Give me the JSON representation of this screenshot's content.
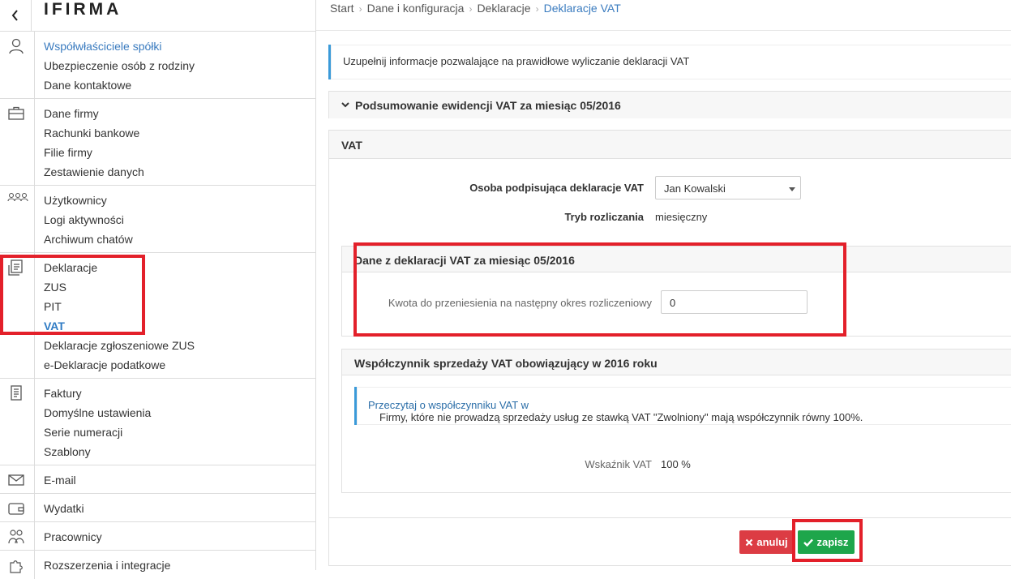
{
  "app": {
    "logo": "IFIRMA"
  },
  "sidebar": {
    "groups": [
      {
        "icon": "person-icon",
        "items": [
          "Współwłaściciele spółki",
          "Ubezpieczenie osób z rodziny",
          "Dane kontaktowe"
        ]
      },
      {
        "icon": "briefcase-icon",
        "items": [
          "Dane firmy",
          "Rachunki bankowe",
          "Filie firmy",
          "Zestawienie danych"
        ]
      },
      {
        "icon": "users-icon",
        "items": [
          "Użytkownicy",
          "Logi aktywności",
          "Archiwum chatów"
        ]
      },
      {
        "icon": "declaration-icon",
        "items": [
          "Deklaracje",
          "ZUS",
          "PIT",
          "VAT",
          "Deklaracje zgłoszeniowe ZUS",
          "e-Deklaracje podatkowe"
        ]
      },
      {
        "icon": "invoice-icon",
        "items": [
          "Faktury",
          "Domyślne ustawienia",
          "Serie numeracji",
          "Szablony"
        ]
      },
      {
        "icon": "envelope-icon",
        "items": [
          "E-mail"
        ]
      },
      {
        "icon": "wallet-icon",
        "items": [
          "Wydatki"
        ]
      },
      {
        "icon": "employees-icon",
        "items": [
          "Pracownicy"
        ]
      },
      {
        "icon": "puzzle-icon",
        "items": [
          "Rozszerzenia i integracje"
        ]
      }
    ]
  },
  "breadcrumb": [
    "Start",
    "Dane i konfiguracja",
    "Deklaracje",
    "Deklaracje VAT"
  ],
  "info": "Uzupełnij informacje pozwalające na prawidłowe wyliczanie deklaracji VAT",
  "summary": {
    "title": "Podsumowanie ewidencji VAT za miesiąc 05/2016"
  },
  "vat": {
    "title": "VAT",
    "signer_label": "Osoba podpisująca deklaracje VAT",
    "signer_value": "Jan Kowalski",
    "mode_label": "Tryb rozliczania",
    "mode_value": "miesięczny",
    "dane": {
      "title": "Dane z deklaracji VAT za miesiąc 05/2016",
      "amount_label": "Kwota do przeniesienia na następny okres rozliczeniowy",
      "amount_value": "0"
    },
    "wsp": {
      "title": "Współczynnik sprzedaży VAT obowiązujący w 2016 roku",
      "notice_text": "Firmy, które nie prowadzą sprzedaży usług ze stawką VAT \"Zwolniony\" mają współczynnik równy 100%.",
      "notice_link": "Przeczytaj o współczynniku VAT w",
      "indicator_label": "Wskaźnik VAT",
      "indicator_value": "100 %"
    }
  },
  "buttons": {
    "cancel": "anuluj",
    "save": "zapisz"
  },
  "colors": {
    "accent": "#3a7bbf",
    "highlight": "#e3202a",
    "save": "#1ea64b",
    "cancel": "#dc3c44"
  }
}
